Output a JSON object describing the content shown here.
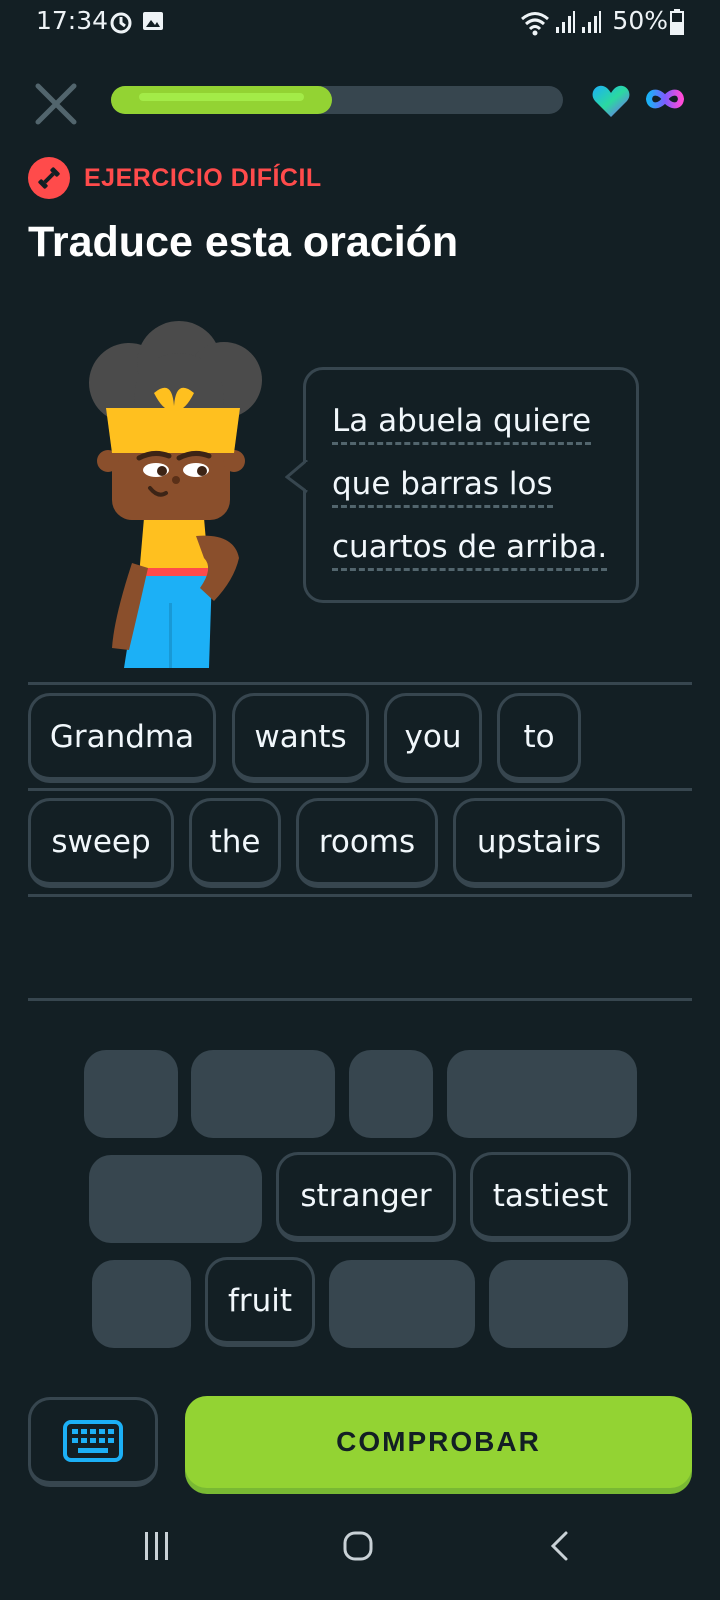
{
  "status_bar": {
    "time": "17:34",
    "battery": "50%"
  },
  "header": {
    "progress_fraction": 0.49,
    "close_icon": "close-icon",
    "hearts_icon": "heart-icon",
    "hearts_value_icon": "infinity-icon"
  },
  "badge": {
    "label": "EJERCICIO DIFÍCIL",
    "icon": "dumbbell-icon"
  },
  "title": "Traduce esta oración",
  "prompt": {
    "lines": [
      "La abuela quiere",
      "que barras los",
      "cuartos de arriba."
    ]
  },
  "answer": {
    "words": [
      "Grandma",
      "wants",
      "you",
      "to",
      "sweep",
      "the",
      "rooms",
      "upstairs"
    ]
  },
  "word_bank": {
    "available": [
      "stranger",
      "tastiest",
      "fruit"
    ]
  },
  "footer": {
    "keyboard_icon": "keyboard-icon",
    "check_label": "COMPROBAR"
  },
  "colors": {
    "background": "#131f24",
    "accent_green": "#93d333",
    "danger_red": "#ff4b4b",
    "border": "#37464f"
  }
}
